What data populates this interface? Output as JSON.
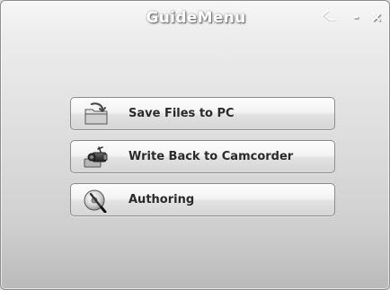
{
  "window": {
    "title": "GuideMenu",
    "controls": {
      "settings_icon": "wrench-icon",
      "minimize_label": "-",
      "close_label": "×"
    }
  },
  "menu": {
    "items": [
      {
        "label": "Save Files to PC",
        "icon": "folder-save-icon"
      },
      {
        "label": "Write Back to Camcorder",
        "icon": "camcorder-icon"
      },
      {
        "label": "Authoring",
        "icon": "disc-authoring-icon"
      }
    ]
  }
}
